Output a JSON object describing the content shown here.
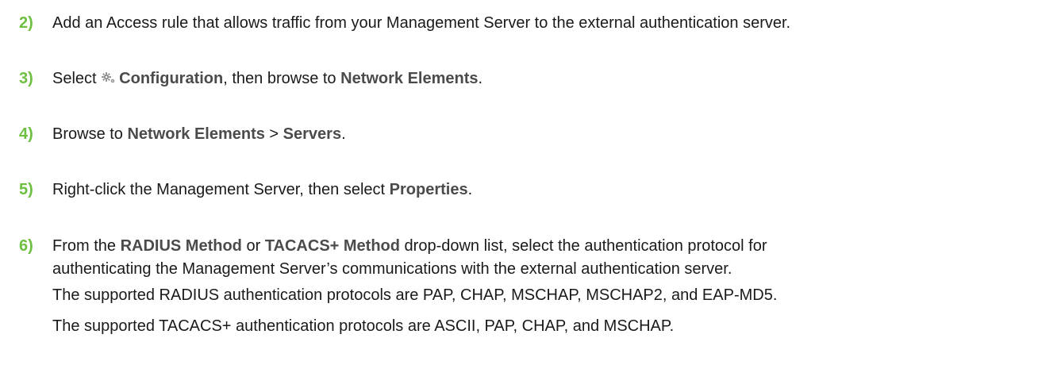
{
  "steps": [
    {
      "number": "2)",
      "text": "Add an Access rule that allows traffic from your Management Server to the external authentication server."
    },
    {
      "number": "3)",
      "pre": "Select ",
      "icon": "gear-icon",
      "bold1": "Configuration",
      "mid": ", then browse to ",
      "bold2": "Network Elements",
      "post": "."
    },
    {
      "number": "4)",
      "pre": "Browse to ",
      "bold1": "Network Elements",
      "mid": " > ",
      "bold2": "Servers",
      "post": "."
    },
    {
      "number": "5)",
      "pre": "Right-click the Management Server, then select ",
      "bold1": "Properties",
      "post": "."
    },
    {
      "number": "6)",
      "pre": "From the ",
      "bold1": "RADIUS Method",
      "mid": " or ",
      "bold2": "TACACS+ Method",
      "post": " drop-down list, select the authentication protocol for",
      "line2": "authenticating the Management Server’s communications with the external authentication server.",
      "note1": "The supported RADIUS authentication protocols are PAP, CHAP, MSCHAP, MSCHAP2, and EAP-MD5.",
      "note2": "The supported TACACS+ authentication protocols are ASCII, PAP, CHAP, and MSCHAP."
    }
  ],
  "colors": {
    "step_number": "#6cbf3f",
    "ui_bold": "#4b4b4b",
    "body_text": "#1a1a1a"
  }
}
